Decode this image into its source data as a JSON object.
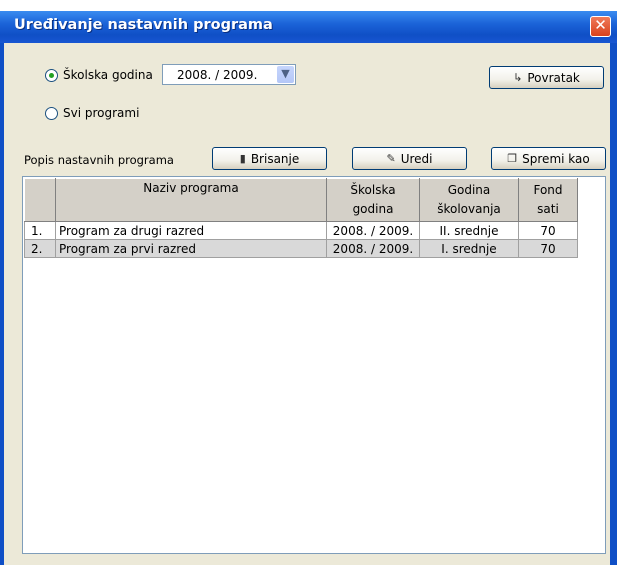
{
  "window": {
    "title": "Uređivanje nastavnih programa",
    "close": "✕"
  },
  "filter": {
    "radio_school_year": "Školska godina",
    "radio_all": "Svi programi",
    "selected": "school_year",
    "school_year_value": "2008. / 2009."
  },
  "toolbar": {
    "back_label": "Povratak",
    "list_label": "Popis nastavnih programa",
    "delete_label": "Brisanje",
    "edit_label": "Uredi",
    "save_as_label": "Spremi kao"
  },
  "table": {
    "headers": {
      "name": "Naziv programa",
      "school_year_1": "Školska",
      "school_year_2": "godina",
      "grade_1": "Godina",
      "grade_2": "školovanja",
      "hours_1": "Fond",
      "hours_2": "sati"
    },
    "rows": [
      {
        "index": "1.",
        "name": "Program za drugi razred",
        "year": "2008. / 2009.",
        "grade": "II. srednje",
        "hours": "70"
      },
      {
        "index": "2.",
        "name": "Program za prvi razred",
        "year": "2008. / 2009.",
        "grade": "I. srednje",
        "hours": "70"
      }
    ]
  }
}
